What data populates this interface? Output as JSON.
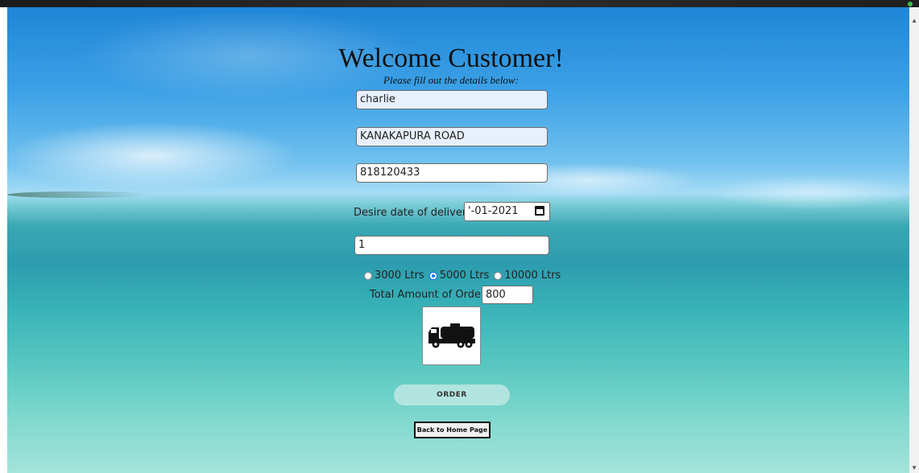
{
  "form": {
    "title": "Welcome Customer!",
    "subtitle": "Please fill out the details below:",
    "name_value": "charlie",
    "address_value": "KANAKAPURA ROAD",
    "phone_value": "818120433",
    "delivery_date_label": "Desire date of delivery:",
    "delivery_date_value": "'-01-2021",
    "quantity_value": "1",
    "capacity_options": [
      {
        "label": "3000 Ltrs",
        "checked": false
      },
      {
        "label": "5000 Ltrs",
        "checked": true
      },
      {
        "label": "10000 Ltrs",
        "checked": false
      }
    ],
    "total_label": "Total Amount of Order:",
    "total_value": "800",
    "order_button": "ORDER",
    "home_button": "Back to Home Page"
  },
  "icons": {
    "truck": "truck-icon",
    "calendar": "calendar-icon"
  },
  "colors": {
    "autofill_background": "#e8f0fe",
    "radio_accent": "#1a73e8",
    "sky": "#3ca1e6",
    "water": "#2c9cae"
  }
}
